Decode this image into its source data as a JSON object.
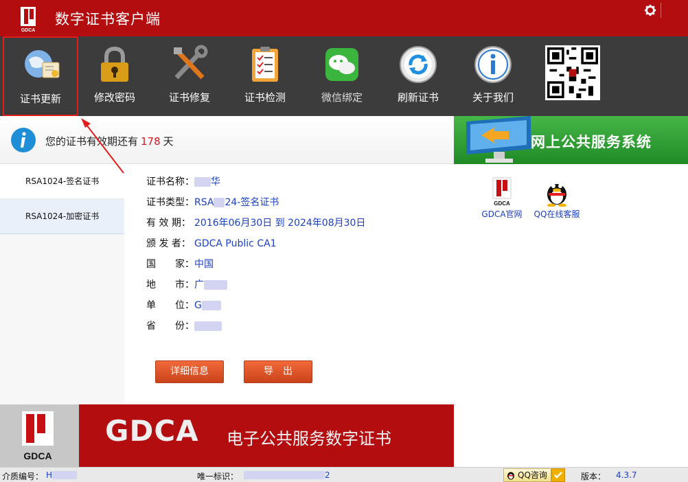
{
  "app": {
    "title": "数字证书客户端",
    "logo_text": "GDCA"
  },
  "toolbar": {
    "items": [
      {
        "label": "证书更新",
        "icon": "cert-update-icon",
        "active": true
      },
      {
        "label": "修改密码",
        "icon": "padlock-icon"
      },
      {
        "label": "证书修复",
        "icon": "repair-tools-icon"
      },
      {
        "label": "证书检测",
        "icon": "checklist-icon"
      },
      {
        "label": "微信绑定",
        "icon": "wechat-icon"
      },
      {
        "label": "刷新证书",
        "icon": "refresh-icon"
      },
      {
        "label": "关于我们",
        "icon": "info-icon"
      }
    ]
  },
  "validity": {
    "prefix": "您的证书有效期还有",
    "days": "178",
    "suffix": "天"
  },
  "banner": {
    "text": "网上公共服务系统"
  },
  "cert_list": [
    {
      "label": "RSA1024-签名证书",
      "selected": false
    },
    {
      "label": "RSA1024-加密证书",
      "selected": true
    }
  ],
  "details": {
    "name": {
      "key": "证书名称：",
      "value": "华"
    },
    "type": {
      "key": "证书类型：",
      "value_pre": "RSA",
      "value_post": "24-签名证书"
    },
    "validity": {
      "key": "有 效 期：",
      "value": "2016年06月30日 到 2024年08月30日"
    },
    "issuer": {
      "key": "颁 发 者：",
      "value": "GDCA Public CA1"
    },
    "country": {
      "key": "国　　家：",
      "value": "中国"
    },
    "city": {
      "key": "地　　市：",
      "value": "广"
    },
    "unit": {
      "key": "单　　位：",
      "value": "G"
    },
    "province": {
      "key": "省　　份：",
      "value": ""
    }
  },
  "buttons": {
    "detail": "详细信息",
    "export": "导　出"
  },
  "links": {
    "gdca": "GDCA官网",
    "qq": "QQ在线客服"
  },
  "footer": {
    "brand": "GDCA",
    "slogan": "电子公共服务数字证书",
    "logo_text": "GDCA"
  },
  "status": {
    "media_label": "介质编号：",
    "media_value": "H",
    "uid_label": "唯一标识：",
    "uid_value": "2",
    "qq_label": "QQ咨询",
    "version_label": "版本：",
    "version_value": "4.3.7"
  },
  "colors": {
    "brand_red": "#b30d10",
    "toolbar_dark": "#3c3c3c",
    "days_red": "#d8141b",
    "link_blue": "#1a3fc0",
    "banner_green": "#2e9a33"
  }
}
